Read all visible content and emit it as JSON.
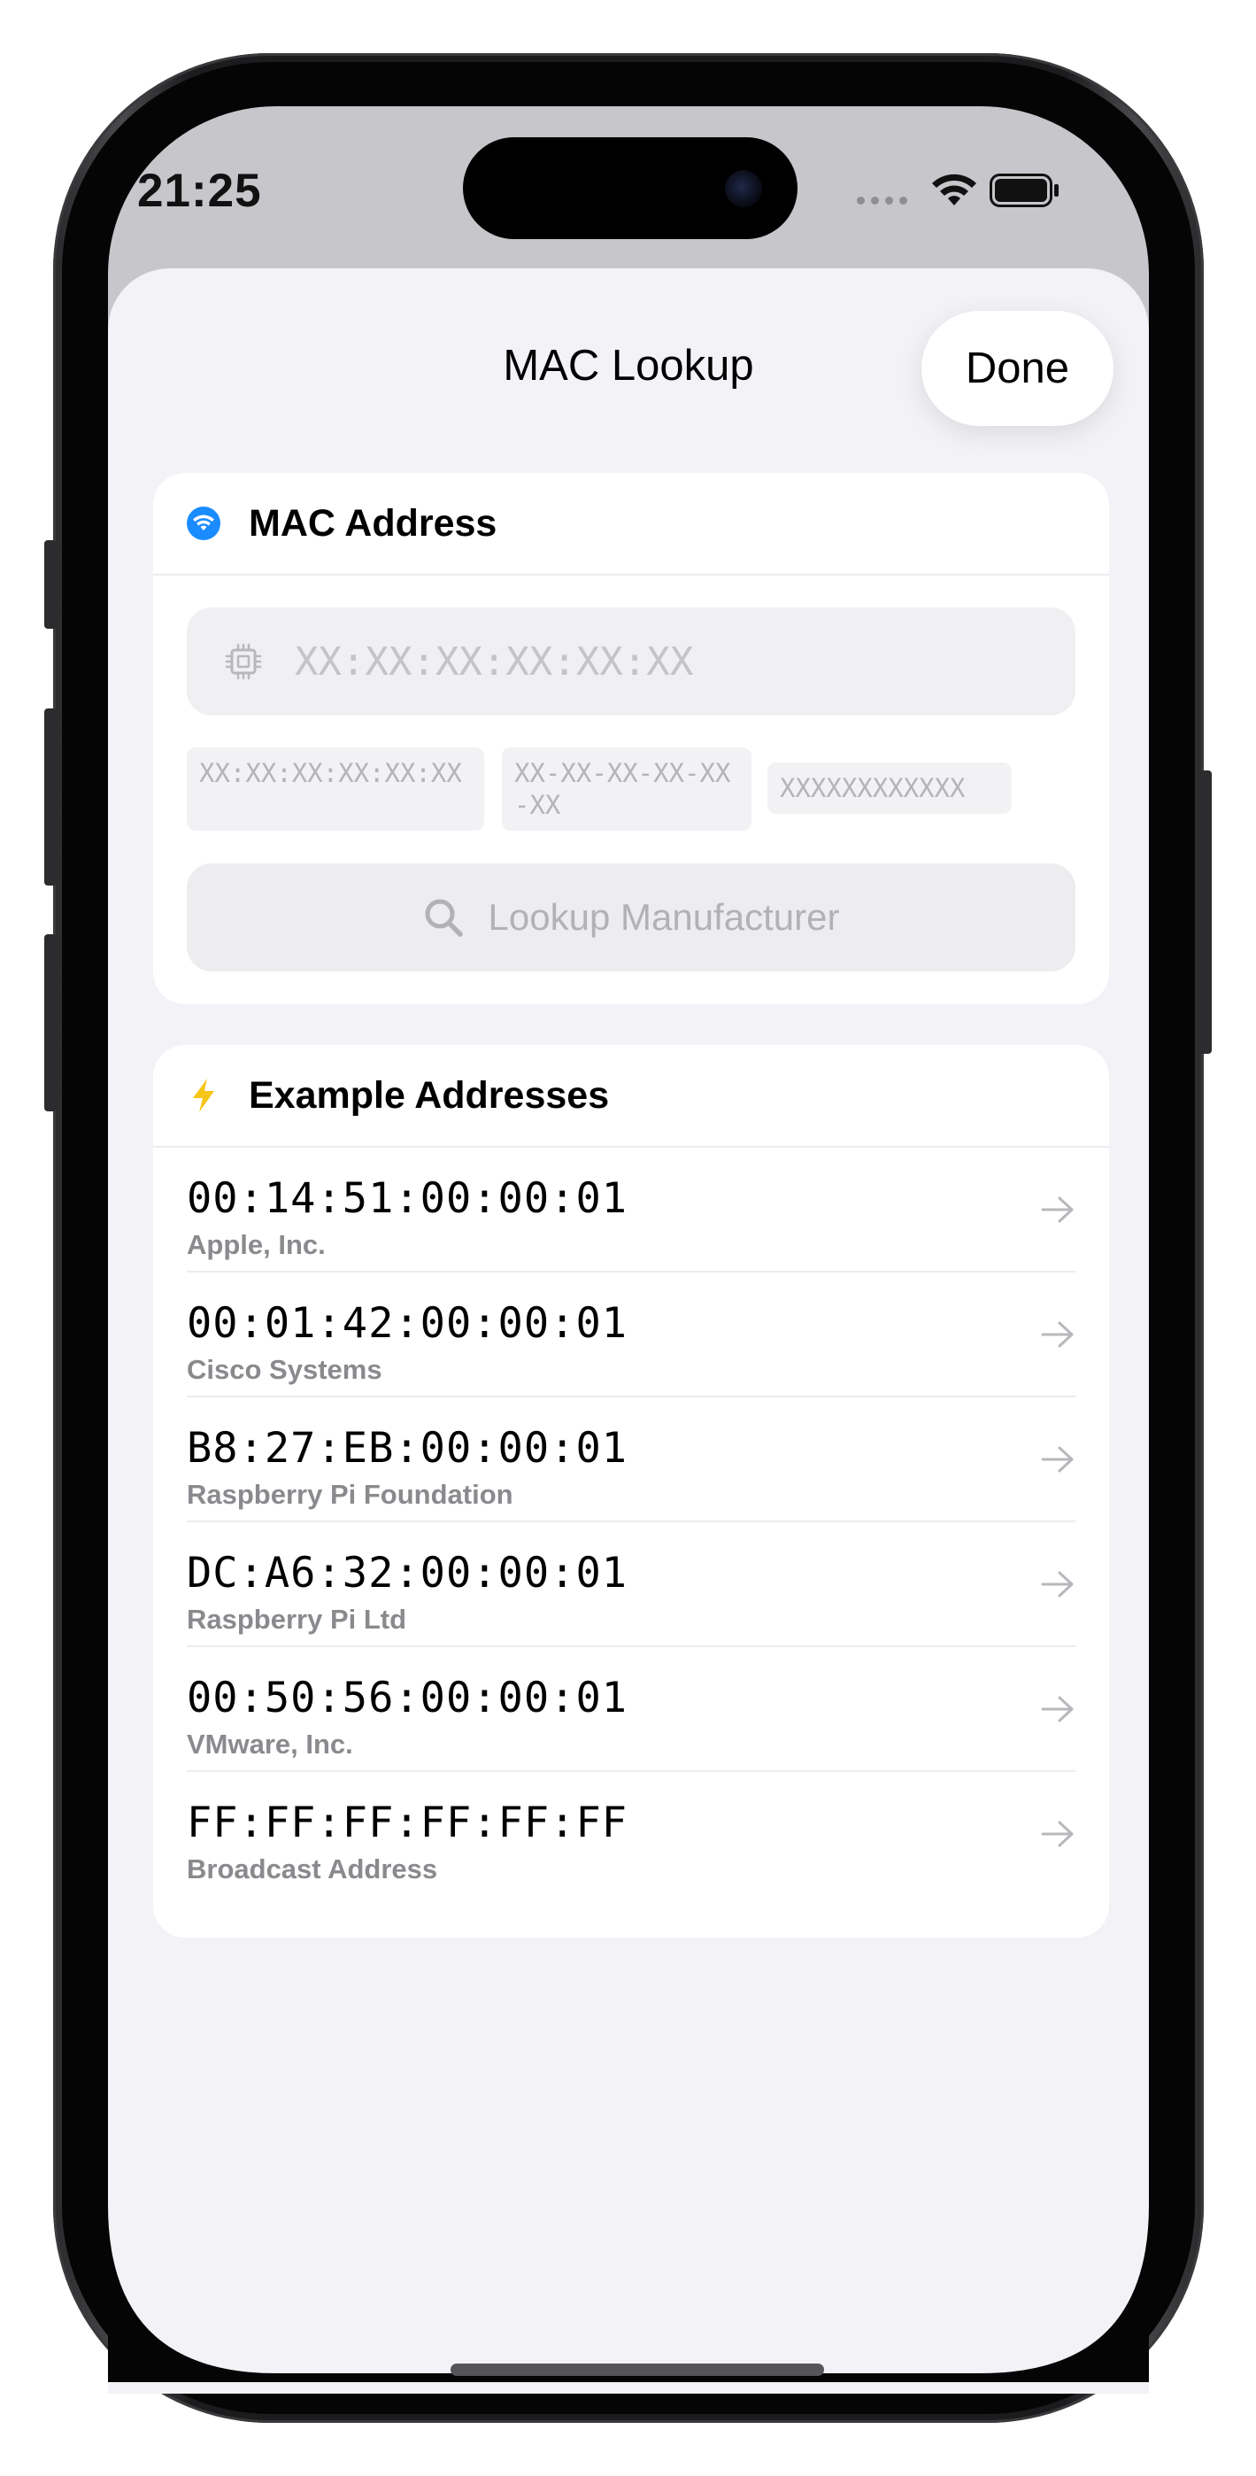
{
  "status_bar": {
    "time": "21:25",
    "icons": [
      "signal-dots-icon",
      "wifi-icon",
      "battery-icon"
    ]
  },
  "nav": {
    "title": "MAC Lookup",
    "done_label": "Done"
  },
  "mac_card": {
    "header_icon": "wifi-circle-icon",
    "header_title": "MAC Address",
    "input_icon": "chip-icon",
    "input_value": "",
    "input_placeholder": "XX:XX:XX:XX:XX:XX",
    "formats": [
      "XX:XX:XX:XX:XX:XX",
      "XX-XX-XX-XX-XX-XX",
      "XXXXXXXXXXXX"
    ],
    "lookup_label": "Lookup Manufacturer",
    "lookup_icon": "magnifying-glass-icon"
  },
  "examples_card": {
    "header_icon": "bolt-icon",
    "header_title": "Example Addresses",
    "items": [
      {
        "mac": "00:14:51:00:00:01",
        "vendor": "Apple, Inc."
      },
      {
        "mac": "00:01:42:00:00:01",
        "vendor": "Cisco Systems"
      },
      {
        "mac": "B8:27:EB:00:00:01",
        "vendor": "Raspberry Pi Foundation"
      },
      {
        "mac": "DC:A6:32:00:00:01",
        "vendor": "Raspberry Pi Ltd"
      },
      {
        "mac": "00:50:56:00:00:01",
        "vendor": "VMware, Inc."
      },
      {
        "mac": "FF:FF:FF:FF:FF:FF",
        "vendor": "Broadcast Address"
      }
    ]
  },
  "colors": {
    "accent_blue": "#1a8cff",
    "bolt_yellow": "#f5c518",
    "sheet_bg": "#f2f2f7",
    "secondary_text": "#8a8a8e"
  }
}
